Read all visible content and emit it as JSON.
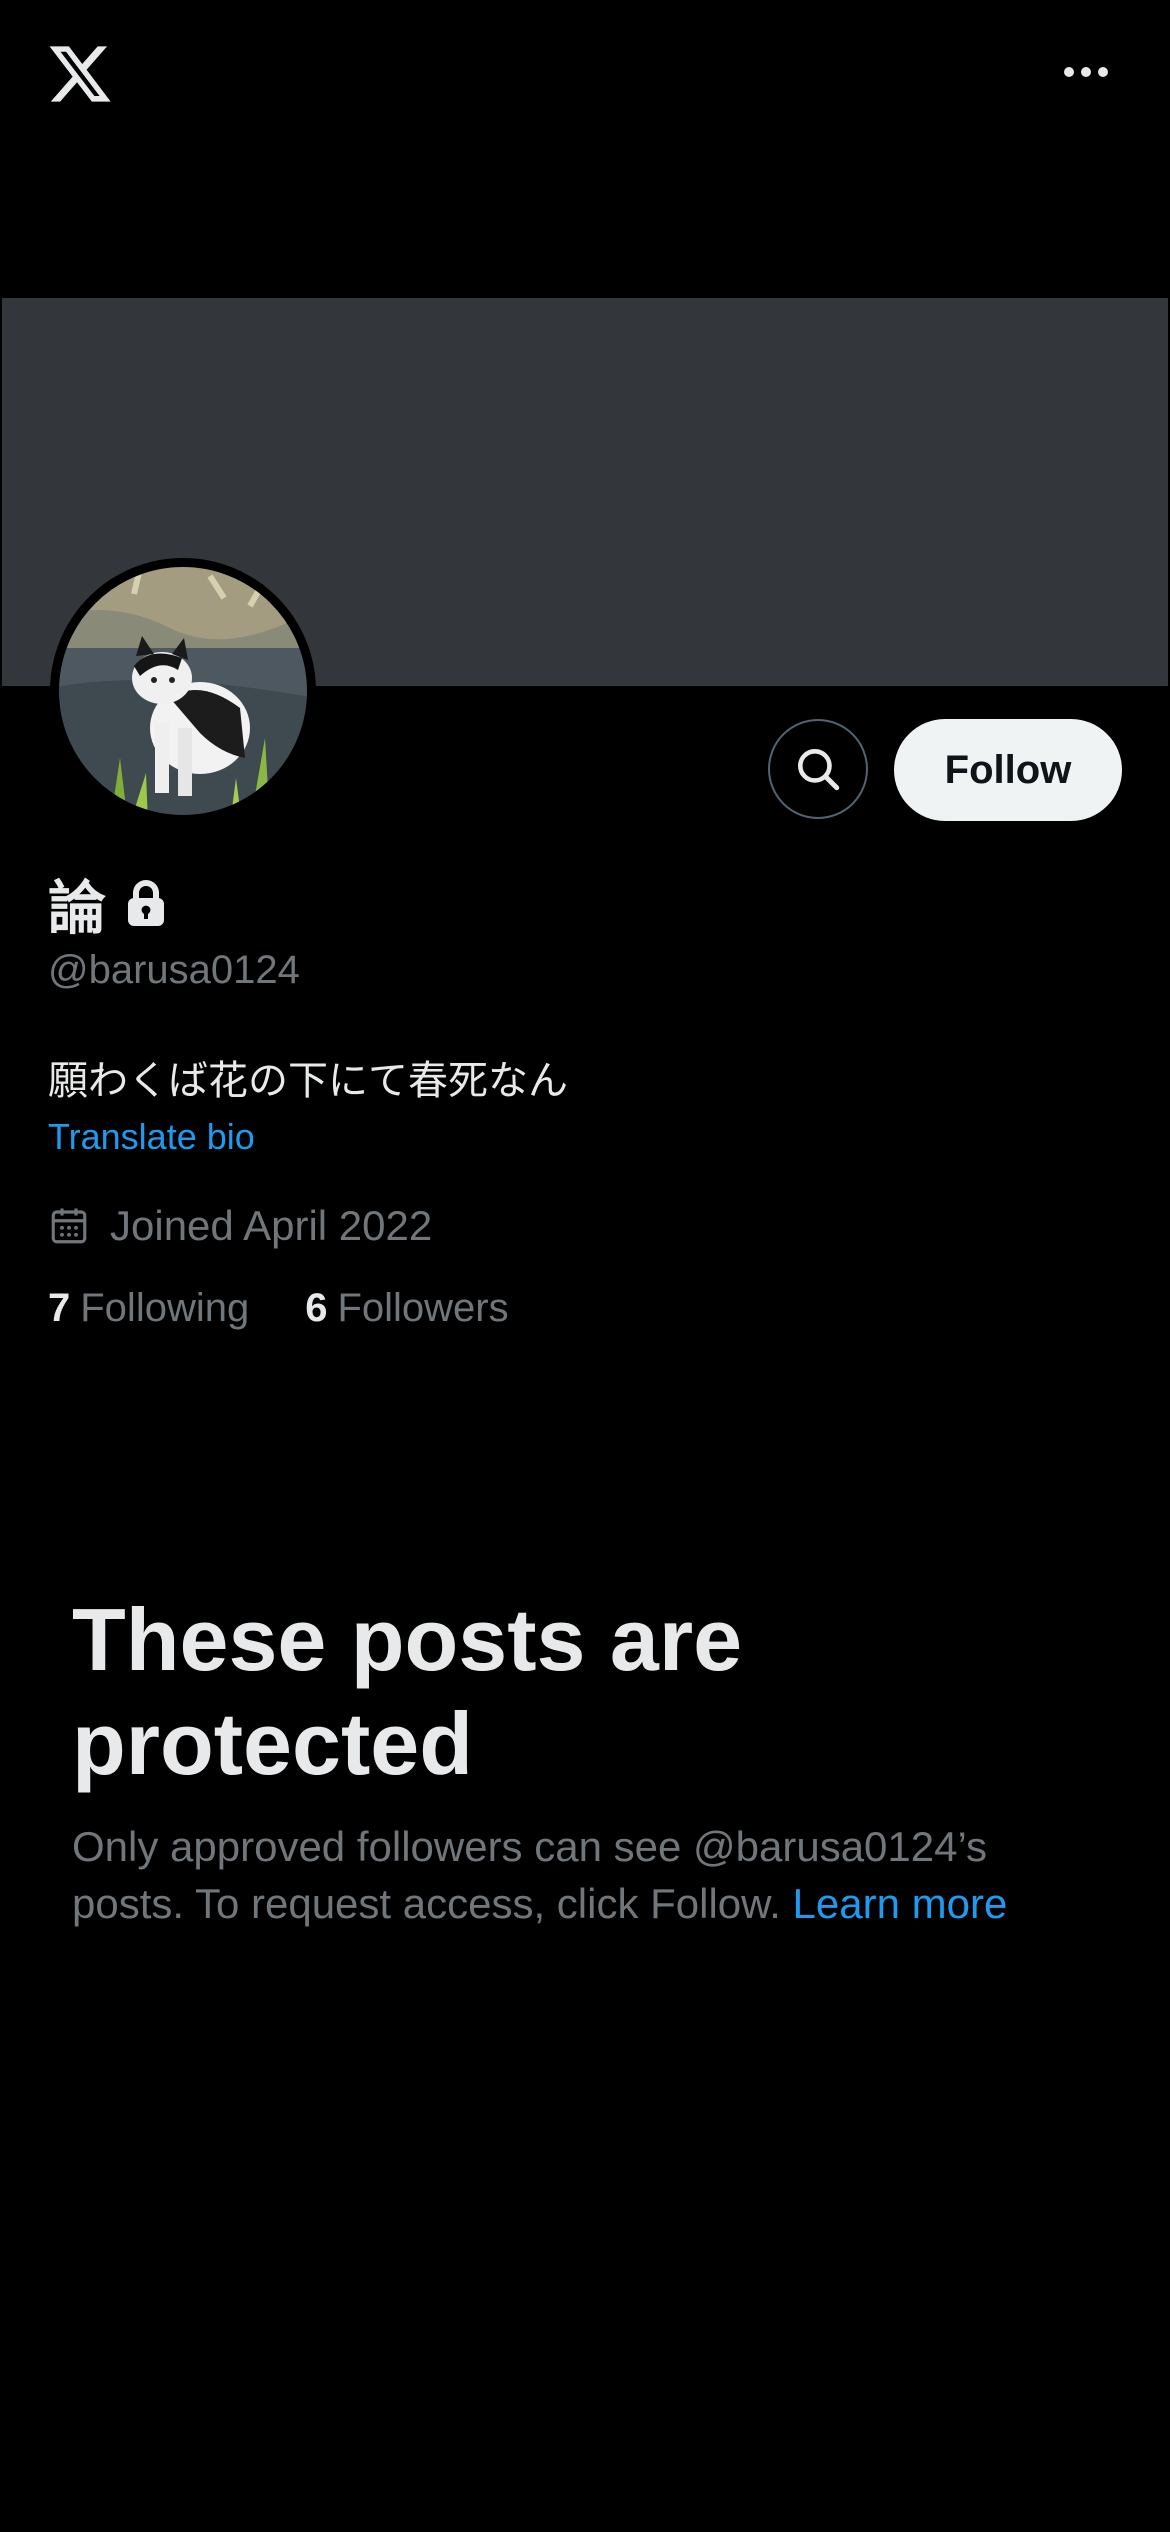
{
  "header": {
    "logo_icon": "x-logo-icon",
    "more_icon": "more-horizontal-icon"
  },
  "profile": {
    "display_name": "論",
    "locked_icon": "lock-icon",
    "handle": "@barusa0124",
    "bio": "願わくば花の下にて春死なん",
    "translate_label": "Translate bio",
    "joined_icon": "calendar-icon",
    "joined_text": "Joined April 2022",
    "following_count": "7",
    "following_label": "Following",
    "followers_count": "6",
    "followers_label": "Followers"
  },
  "actions": {
    "search_icon": "search-icon",
    "follow_label": "Follow"
  },
  "protected": {
    "title": "These posts are protected",
    "description": "Only approved followers can see @barusa0124’s posts. To request access, click Follow.",
    "learn_more_label": "Learn more"
  },
  "colors": {
    "background": "#000000",
    "banner": "#33363a",
    "text_primary": "#e7e9ea",
    "text_secondary": "#71767b",
    "link": "#1d9bf0",
    "follow_button_bg": "#eff3f4"
  }
}
